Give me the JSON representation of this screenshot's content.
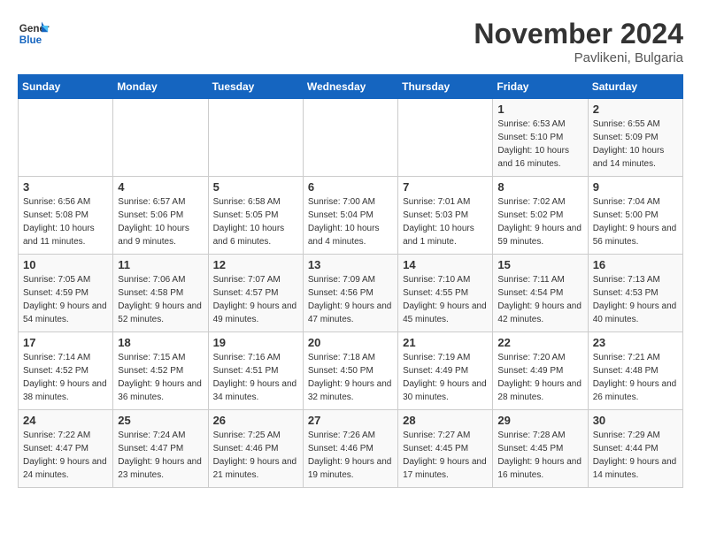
{
  "header": {
    "logo_general": "General",
    "logo_blue": "Blue",
    "month_title": "November 2024",
    "location": "Pavlikeni, Bulgaria"
  },
  "weekdays": [
    "Sunday",
    "Monday",
    "Tuesday",
    "Wednesday",
    "Thursday",
    "Friday",
    "Saturday"
  ],
  "weeks": [
    [
      {
        "day": "",
        "info": ""
      },
      {
        "day": "",
        "info": ""
      },
      {
        "day": "",
        "info": ""
      },
      {
        "day": "",
        "info": ""
      },
      {
        "day": "",
        "info": ""
      },
      {
        "day": "1",
        "info": "Sunrise: 6:53 AM\nSunset: 5:10 PM\nDaylight: 10 hours and 16 minutes."
      },
      {
        "day": "2",
        "info": "Sunrise: 6:55 AM\nSunset: 5:09 PM\nDaylight: 10 hours and 14 minutes."
      }
    ],
    [
      {
        "day": "3",
        "info": "Sunrise: 6:56 AM\nSunset: 5:08 PM\nDaylight: 10 hours and 11 minutes."
      },
      {
        "day": "4",
        "info": "Sunrise: 6:57 AM\nSunset: 5:06 PM\nDaylight: 10 hours and 9 minutes."
      },
      {
        "day": "5",
        "info": "Sunrise: 6:58 AM\nSunset: 5:05 PM\nDaylight: 10 hours and 6 minutes."
      },
      {
        "day": "6",
        "info": "Sunrise: 7:00 AM\nSunset: 5:04 PM\nDaylight: 10 hours and 4 minutes."
      },
      {
        "day": "7",
        "info": "Sunrise: 7:01 AM\nSunset: 5:03 PM\nDaylight: 10 hours and 1 minute."
      },
      {
        "day": "8",
        "info": "Sunrise: 7:02 AM\nSunset: 5:02 PM\nDaylight: 9 hours and 59 minutes."
      },
      {
        "day": "9",
        "info": "Sunrise: 7:04 AM\nSunset: 5:00 PM\nDaylight: 9 hours and 56 minutes."
      }
    ],
    [
      {
        "day": "10",
        "info": "Sunrise: 7:05 AM\nSunset: 4:59 PM\nDaylight: 9 hours and 54 minutes."
      },
      {
        "day": "11",
        "info": "Sunrise: 7:06 AM\nSunset: 4:58 PM\nDaylight: 9 hours and 52 minutes."
      },
      {
        "day": "12",
        "info": "Sunrise: 7:07 AM\nSunset: 4:57 PM\nDaylight: 9 hours and 49 minutes."
      },
      {
        "day": "13",
        "info": "Sunrise: 7:09 AM\nSunset: 4:56 PM\nDaylight: 9 hours and 47 minutes."
      },
      {
        "day": "14",
        "info": "Sunrise: 7:10 AM\nSunset: 4:55 PM\nDaylight: 9 hours and 45 minutes."
      },
      {
        "day": "15",
        "info": "Sunrise: 7:11 AM\nSunset: 4:54 PM\nDaylight: 9 hours and 42 minutes."
      },
      {
        "day": "16",
        "info": "Sunrise: 7:13 AM\nSunset: 4:53 PM\nDaylight: 9 hours and 40 minutes."
      }
    ],
    [
      {
        "day": "17",
        "info": "Sunrise: 7:14 AM\nSunset: 4:52 PM\nDaylight: 9 hours and 38 minutes."
      },
      {
        "day": "18",
        "info": "Sunrise: 7:15 AM\nSunset: 4:52 PM\nDaylight: 9 hours and 36 minutes."
      },
      {
        "day": "19",
        "info": "Sunrise: 7:16 AM\nSunset: 4:51 PM\nDaylight: 9 hours and 34 minutes."
      },
      {
        "day": "20",
        "info": "Sunrise: 7:18 AM\nSunset: 4:50 PM\nDaylight: 9 hours and 32 minutes."
      },
      {
        "day": "21",
        "info": "Sunrise: 7:19 AM\nSunset: 4:49 PM\nDaylight: 9 hours and 30 minutes."
      },
      {
        "day": "22",
        "info": "Sunrise: 7:20 AM\nSunset: 4:49 PM\nDaylight: 9 hours and 28 minutes."
      },
      {
        "day": "23",
        "info": "Sunrise: 7:21 AM\nSunset: 4:48 PM\nDaylight: 9 hours and 26 minutes."
      }
    ],
    [
      {
        "day": "24",
        "info": "Sunrise: 7:22 AM\nSunset: 4:47 PM\nDaylight: 9 hours and 24 minutes."
      },
      {
        "day": "25",
        "info": "Sunrise: 7:24 AM\nSunset: 4:47 PM\nDaylight: 9 hours and 23 minutes."
      },
      {
        "day": "26",
        "info": "Sunrise: 7:25 AM\nSunset: 4:46 PM\nDaylight: 9 hours and 21 minutes."
      },
      {
        "day": "27",
        "info": "Sunrise: 7:26 AM\nSunset: 4:46 PM\nDaylight: 9 hours and 19 minutes."
      },
      {
        "day": "28",
        "info": "Sunrise: 7:27 AM\nSunset: 4:45 PM\nDaylight: 9 hours and 17 minutes."
      },
      {
        "day": "29",
        "info": "Sunrise: 7:28 AM\nSunset: 4:45 PM\nDaylight: 9 hours and 16 minutes."
      },
      {
        "day": "30",
        "info": "Sunrise: 7:29 AM\nSunset: 4:44 PM\nDaylight: 9 hours and 14 minutes."
      }
    ]
  ]
}
